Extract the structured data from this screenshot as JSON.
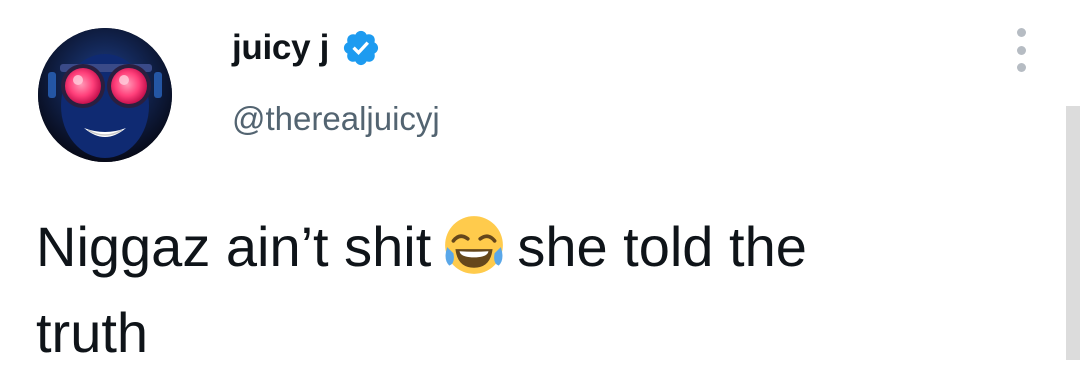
{
  "tweet": {
    "author": {
      "display_name": "juicy j",
      "handle": "@therealjuicyj",
      "verified": true,
      "avatar_icon": "profile-avatar"
    },
    "text_before_emoji": "Niggaz ain’t shit",
    "emoji": "face-with-tears-of-joy",
    "text_after_emoji": "she told the",
    "text_line2": "truth",
    "more_icon": "vertical-ellipsis-icon"
  },
  "colors": {
    "text": "#0f1419",
    "secondary": "#536471",
    "verified_blue": "#1d9bf0"
  }
}
